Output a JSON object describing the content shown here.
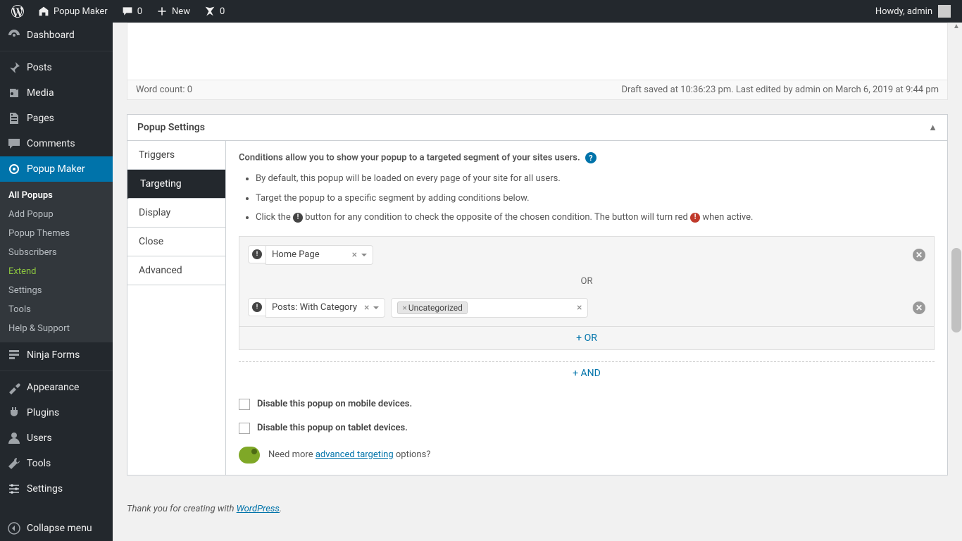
{
  "adminbar": {
    "site_name": "Popup Maker",
    "comments_count": "0",
    "new_label": "New",
    "plane_count": "0",
    "howdy": "Howdy, admin"
  },
  "sidebar": {
    "dashboard": "Dashboard",
    "posts": "Posts",
    "media": "Media",
    "pages": "Pages",
    "comments": "Comments",
    "popup_maker": "Popup Maker",
    "submenu": {
      "all_popups": "All Popups",
      "add_popup": "Add Popup",
      "popup_themes": "Popup Themes",
      "subscribers": "Subscribers",
      "extend": "Extend",
      "settings": "Settings",
      "tools": "Tools",
      "help": "Help & Support"
    },
    "ninja_forms": "Ninja Forms",
    "appearance": "Appearance",
    "plugins": "Plugins",
    "users": "Users",
    "tools": "Tools",
    "settings_main": "Settings",
    "collapse": "Collapse menu"
  },
  "editor": {
    "word_count": "Word count: 0",
    "save_status": "Draft saved at 10:36:23 pm. Last edited by admin on March 6, 2019 at 9:44 pm"
  },
  "settings_box": {
    "title": "Popup Settings",
    "tabs": {
      "triggers": "Triggers",
      "targeting": "Targeting",
      "display": "Display",
      "close": "Close",
      "advanced": "Advanced"
    },
    "targeting": {
      "intro": "Conditions allow you to show your popup to a targeted segment of your sites users.",
      "bullet1": "By default, this popup will be loaded on every page of your site for all users.",
      "bullet2": "Target the popup to a specific segment by adding conditions below.",
      "bullet3a": "Click the ",
      "bullet3b": " button for any condition to check the opposite of the chosen condition. The button will turn red ",
      "bullet3c": " when active.",
      "condition1": "Home Page",
      "or_label": "OR",
      "condition2": "Posts: With Category",
      "tag_uncategorized": "Uncategorized",
      "add_or": "+ OR",
      "add_and": "+ AND",
      "disable_mobile": "Disable this popup on mobile devices.",
      "disable_tablet": "Disable this popup on tablet devices.",
      "advanced_pre": "Need more ",
      "advanced_link": "advanced targeting",
      "advanced_post": " options?"
    }
  },
  "footer": {
    "thanks_pre": "Thank you for creating with ",
    "wp_link": "WordPress",
    "thanks_post": "."
  }
}
